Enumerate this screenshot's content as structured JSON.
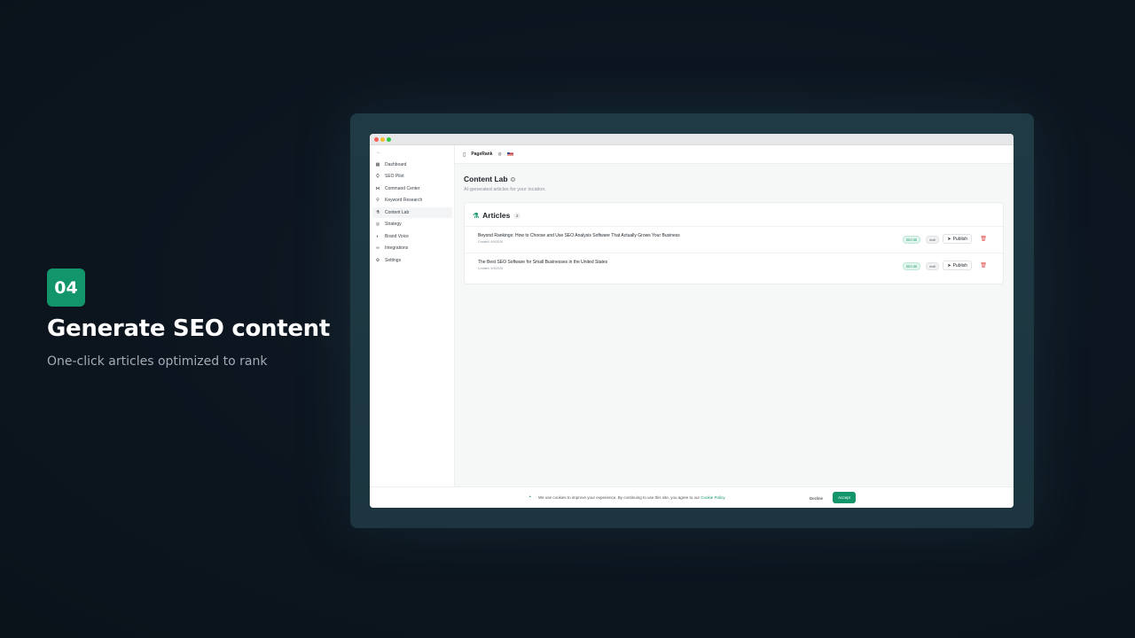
{
  "promo": {
    "step": "04",
    "title": "Generate SEO content",
    "subtitle": "One-click articles optimized to rank"
  },
  "app": {
    "topbar": {
      "brand": "PageRank"
    },
    "sidebar": {
      "collapse": "←",
      "items": [
        {
          "label": "Dashboard",
          "icon": "dashboard-icon"
        },
        {
          "label": "SEO Pilot",
          "icon": "pilot-icon"
        },
        {
          "label": "Command Center",
          "icon": "command-icon"
        },
        {
          "label": "Keyword Research",
          "icon": "search-icon"
        },
        {
          "label": "Content Lab",
          "icon": "flask-icon",
          "active": true
        },
        {
          "label": "Strategy",
          "icon": "target-icon"
        },
        {
          "label": "Brand Voice",
          "icon": "palette-icon"
        },
        {
          "label": "Integrations",
          "icon": "link-icon"
        },
        {
          "label": "Settings",
          "icon": "gear-icon"
        }
      ]
    },
    "page": {
      "title": "Content Lab",
      "subtitle": "AI-generated articles for your location."
    },
    "articles": {
      "heading": "Articles",
      "count": "2",
      "items": [
        {
          "title": "Beyond Rankings: How to Choose and Use SEO Analysis Software That Actually Grows Your Business",
          "date": "Created: 4/9/2026",
          "seo_tag": "SEO 88",
          "status": "draft",
          "publish": "Publish"
        },
        {
          "title": "The Best SEO Software for Small Businesses in the United States",
          "date": "Created: 4/9/2026",
          "seo_tag": "SEO 88",
          "status": "draft",
          "publish": "Publish"
        }
      ]
    },
    "cookie": {
      "text": "We use cookies to improve your experience. By continuing to use this site, you agree to our",
      "link": "Cookie Policy",
      "decline": "Decline",
      "accept": "Accept"
    }
  },
  "colors": {
    "accent": "#12956a",
    "background": "#0d1620",
    "danger": "#e24b4b"
  }
}
